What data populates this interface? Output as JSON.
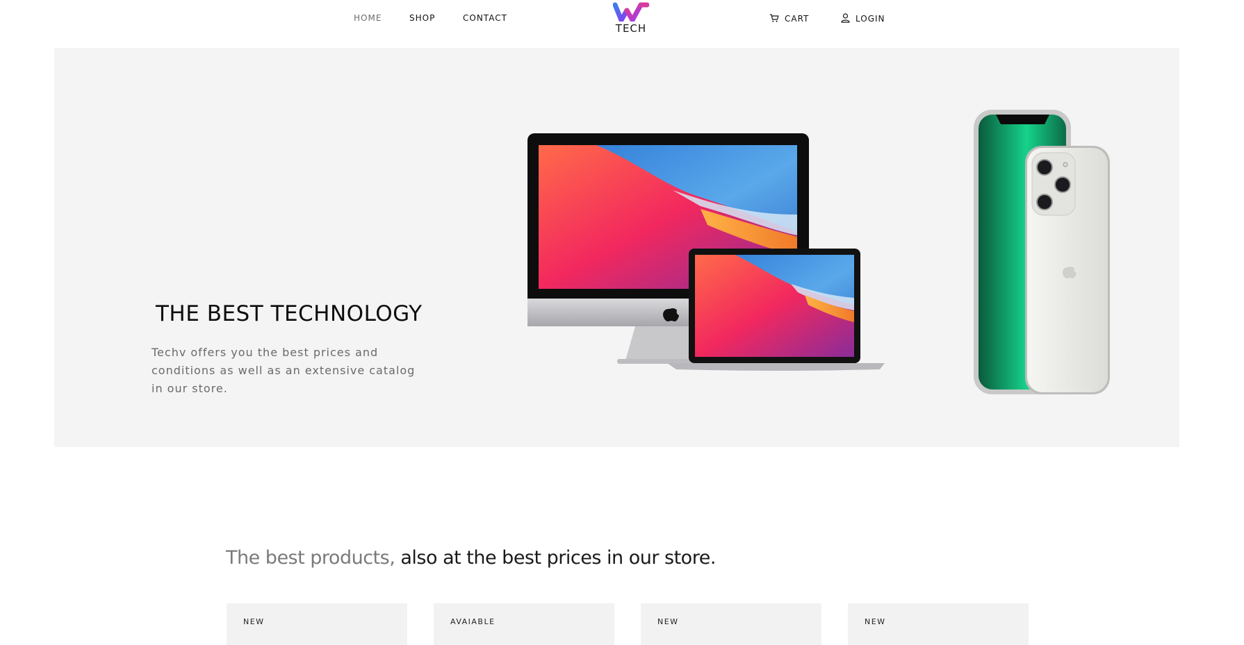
{
  "nav": {
    "home": "HOME",
    "shop": "SHOP",
    "contact": "CONTACT",
    "cart": "CART",
    "login": "LOGIN",
    "logo_text": "TECH",
    "cart_icon": "cart-icon",
    "login_icon": "user-icon"
  },
  "hero": {
    "title": "THE BEST TECHNOLOGY",
    "description": "Techv offers you the best prices and conditions as well as an extensive catalog in our store."
  },
  "products": {
    "tagline_muted": "The best products,",
    "tagline_main": " also at the best prices in our store.",
    "cards": [
      {
        "badge": "NEW"
      },
      {
        "badge": "AVAIABLE"
      },
      {
        "badge": "NEW"
      },
      {
        "badge": "NEW"
      }
    ]
  },
  "colors": {
    "hero_bg": "#f4f4f4",
    "logo_pink": "#e23a8c",
    "logo_blue": "#3c7bf0",
    "text_muted": "#6a6a6a"
  }
}
